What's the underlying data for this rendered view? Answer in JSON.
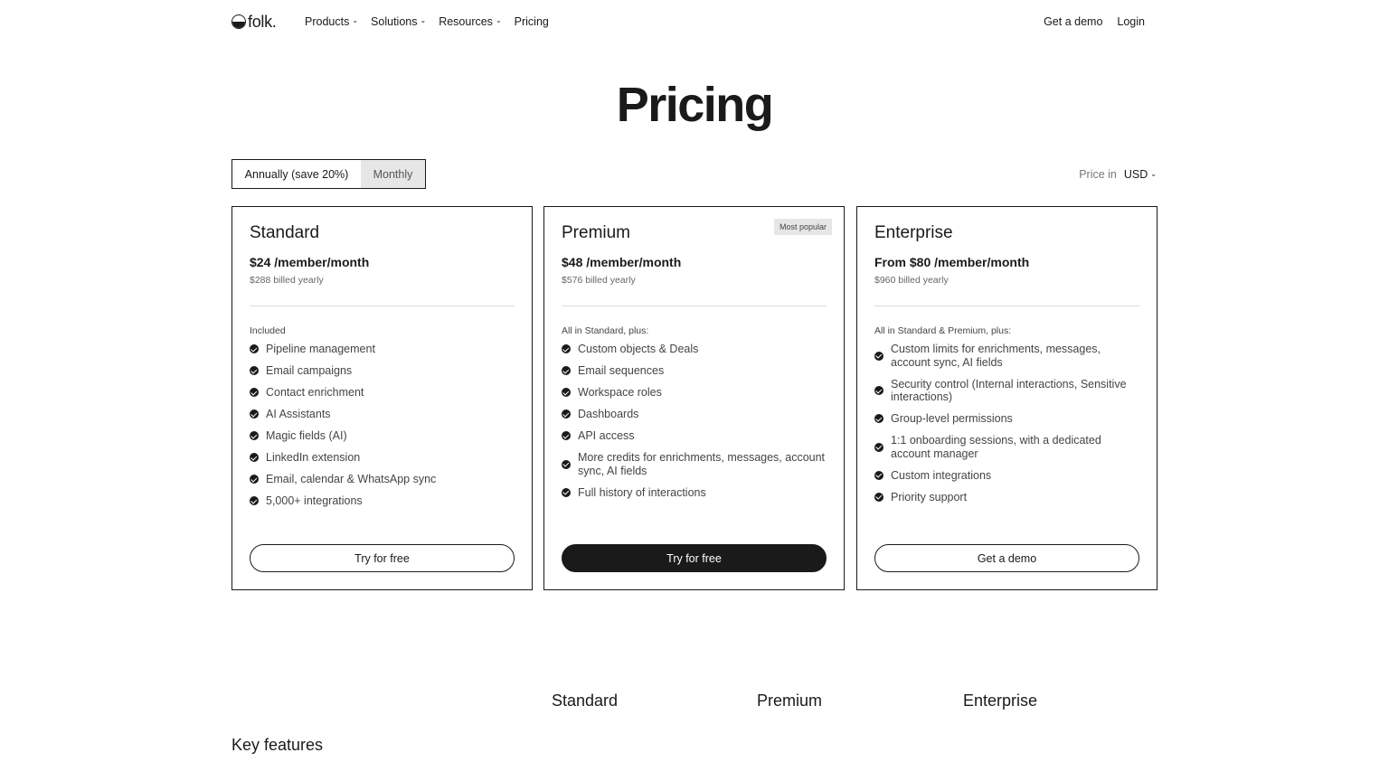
{
  "nav": {
    "logo": "folk.",
    "links": [
      "Products",
      "Solutions",
      "Resources",
      "Pricing"
    ],
    "get_demo": "Get a demo",
    "login": "Login"
  },
  "page_title": "Pricing",
  "billing": {
    "annual": "Annually (save 20%)",
    "monthly": "Monthly",
    "selected": "Annually (save 20%)"
  },
  "currency": {
    "label": "Price in",
    "value": "USD"
  },
  "plans": [
    {
      "name": "Standard",
      "price": "$24 /member/month",
      "billed": "$288 billed yearly",
      "included_label": "Included",
      "features": [
        "Pipeline management",
        "Email campaigns",
        "Contact enrichment",
        "AI Assistants",
        "Magic fields (AI)",
        "LinkedIn extension",
        "Email, calendar & WhatsApp sync",
        "5,000+ integrations"
      ],
      "cta": "Try for free"
    },
    {
      "name": "Premium",
      "badge": "Most popular",
      "price": "$48 /member/month",
      "billed": "$576 billed yearly",
      "included_label": "All in Standard, plus:",
      "features": [
        "Custom objects & Deals",
        "Email sequences",
        "Workspace roles",
        "Dashboards",
        "API access",
        "More credits for enrichments, messages, account sync, AI fields",
        "Full history of interactions"
      ],
      "cta": "Try for free"
    },
    {
      "name": "Enterprise",
      "price": "From $80 /member/month",
      "billed": "$960 billed yearly",
      "included_label": "All in Standard & Premium, plus:",
      "features": [
        "Custom limits for enrichments, messages, account sync, AI fields",
        "Security control (Internal interactions, Sensitive interactions)",
        "Group-level permissions",
        "1:1 onboarding sessions, with a dedicated account manager",
        "Custom integrations",
        "Priority support"
      ],
      "cta": "Get a demo"
    }
  ],
  "comparison": {
    "columns": [
      "Standard",
      "Premium",
      "Enterprise"
    ],
    "section_title": "Key features"
  }
}
